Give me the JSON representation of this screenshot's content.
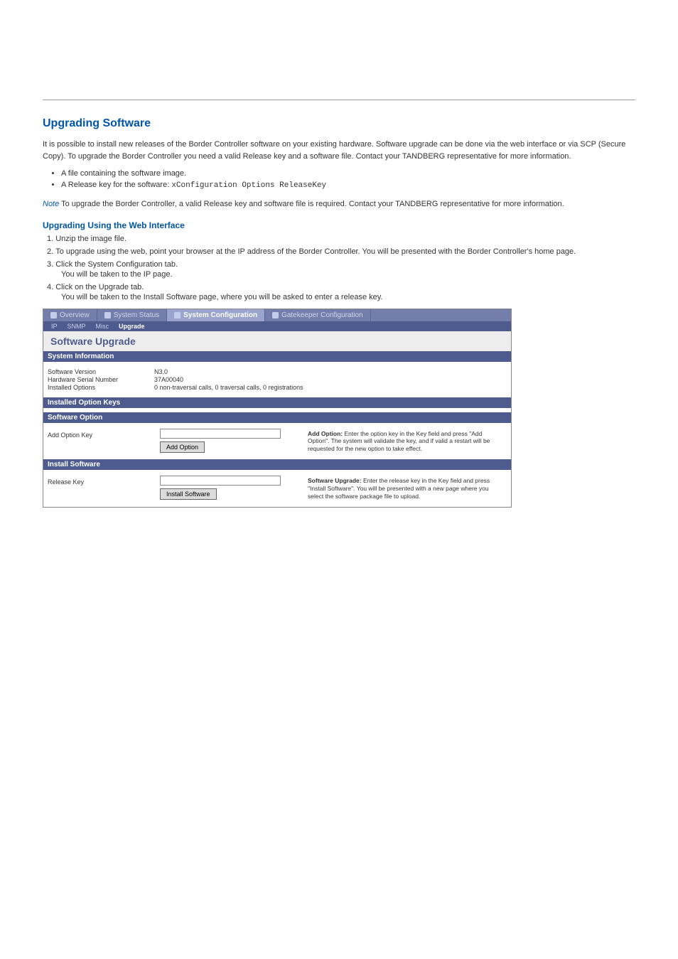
{
  "doc": {
    "title": "Upgrading Software",
    "intro_p1": "It is possible to install new releases of the Border Controller software on your existing hardware. Software upgrade can be done via the web interface or via SCP (Secure Copy). To upgrade the Border Controller you need a valid Release key and a software file. Contact your TANDBERG representative for more information.",
    "li1a": "A file containing the software image.",
    "li1b_prefix": "A Release key for the software: ",
    "li1b_code": "xConfiguration Options ReleaseKey",
    "note_label": "Note",
    "note_body": "  To upgrade the Border Controller, a valid Release key and software file is required. Contact your TANDBERG representative for more information.",
    "web_heading": "Upgrading Using the Web Interface",
    "web_ol": [
      {
        "text": "Unzip the image file.",
        "follow": ""
      },
      {
        "text": "To upgrade using the web, point your browser at the IP address of the Border Controller. You will be presented with the Border Controller's home page.",
        "follow": ""
      },
      {
        "text": "Click the System Configuration tab.",
        "follow": "You will be taken to the IP page."
      },
      {
        "text": "Click on the Upgrade tab.",
        "follow": "You will be taken to the Install Software page, where you will be asked to enter a release key."
      }
    ]
  },
  "ui": {
    "main_tabs": [
      "Overview",
      "System Status",
      "System Configuration",
      "Gatekeeper Configuration"
    ],
    "sub_tabs": [
      "IP",
      "SNMP",
      "Misc",
      "Upgrade"
    ],
    "page_heading": "Software Upgrade",
    "sections": {
      "sysinfo": {
        "title": "System Information",
        "rows": [
          {
            "k": "Software Version",
            "v": "N3.0"
          },
          {
            "k": "Hardware Serial Number",
            "v": "37A00040"
          },
          {
            "k": "Installed Options",
            "v": "0 non-traversal calls, 0 traversal calls, 0 registrations"
          }
        ]
      },
      "installed_keys": {
        "title": "Installed Option Keys"
      },
      "software_option": {
        "title": "Software Option",
        "label": "Add Option Key",
        "button": "Add Option",
        "help_bold": "Add Option:",
        "help_text": " Enter the option key in the Key field and press \"Add Option\". The system will validate the key, and if valid a restart will be requested for the new option to take effect."
      },
      "install_software": {
        "title": "Install Software",
        "label": "Release Key",
        "button": "Install Software",
        "help_bold": "Software Upgrade:",
        "help_text": " Enter the release key in the Key field and press \"Install Software\". You will be presented with a new page where you select the software package file to upload."
      }
    }
  }
}
